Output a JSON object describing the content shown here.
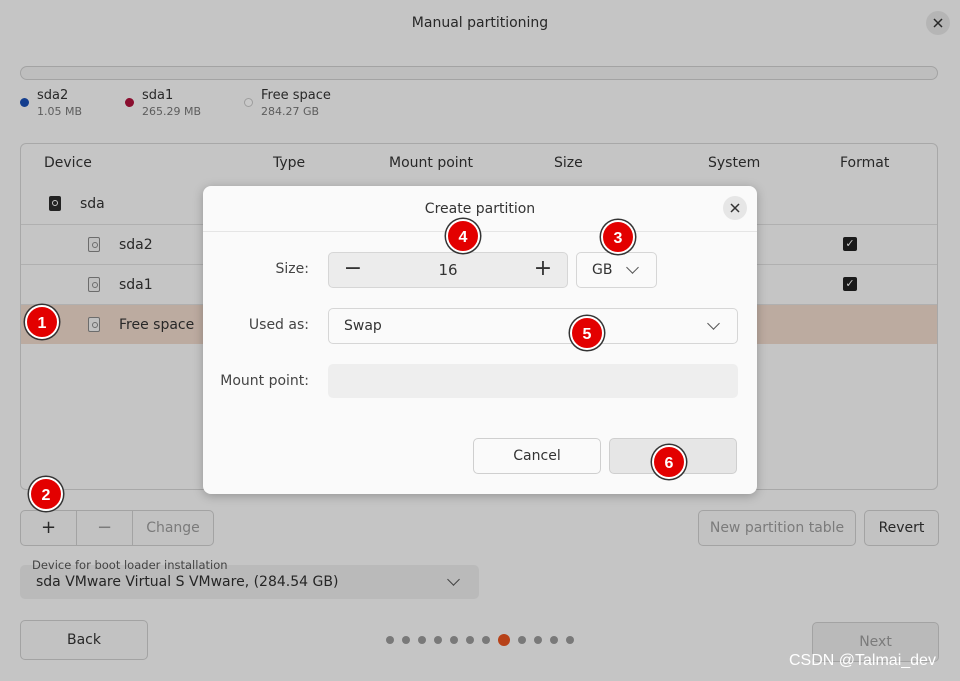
{
  "window": {
    "title": "Manual partitioning"
  },
  "legend": [
    {
      "name": "sda2",
      "size": "1.05 MB",
      "color": "#1a4fb4"
    },
    {
      "name": "sda1",
      "size": "265.29 MB",
      "color": "#b0123c"
    },
    {
      "name": "Free space",
      "size": "284.27 GB",
      "color": "#ffffff"
    }
  ],
  "table": {
    "columns": [
      "Device",
      "Type",
      "Mount point",
      "Size",
      "System",
      "Format"
    ],
    "rows": [
      {
        "device": "sda"
      },
      {
        "device": "sda2",
        "format_checked": true
      },
      {
        "device": "sda1",
        "format_checked": true
      },
      {
        "device": "Free space",
        "selected": true
      }
    ]
  },
  "toolbar": {
    "add": "+",
    "remove": "−",
    "change": "Change",
    "new_table": "New partition table",
    "revert": "Revert"
  },
  "bootloader": {
    "label": "Device for boot loader installation",
    "value": "sda VMware Virtual S VMware, (284.54 GB)"
  },
  "nav": {
    "back": "Back",
    "next": "Next",
    "steps_total": 12,
    "step_active": 8
  },
  "dialog": {
    "title": "Create partition",
    "size_label": "Size:",
    "size_minus": "−",
    "size_value": "16",
    "size_plus": "+",
    "unit": "GB",
    "used_as_label": "Used as:",
    "used_as_value": "Swap",
    "mount_label": "Mount point:",
    "mount_value": "",
    "cancel": "Cancel",
    "ok": ""
  },
  "annotations": [
    "1",
    "2",
    "3",
    "4",
    "5",
    "6"
  ],
  "watermark": "CSDN @Talmai_dev",
  "colors": {
    "accent": "#e95420",
    "badge": "#e30000",
    "selected_row": "#efd9cc"
  }
}
